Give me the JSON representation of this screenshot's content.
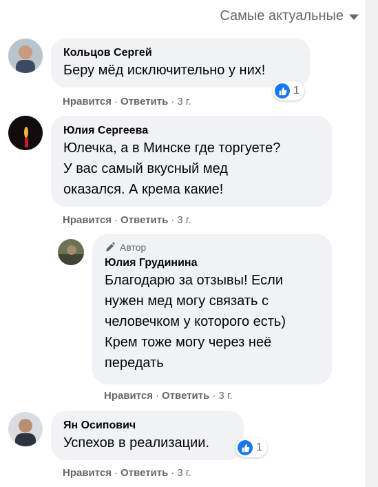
{
  "sort": {
    "label": "Самые актуальные"
  },
  "colors": {
    "bubble": "#f0f2f5",
    "meta": "#65676b",
    "like": "#1877f2"
  },
  "comments": [
    {
      "author": "Кольцов Сергей",
      "lines": [
        "Беру мёд исключительно у них!"
      ],
      "like_label": "Нравится",
      "reply_label": "Ответить",
      "time": "3 г.",
      "reactions": "1"
    },
    {
      "author": "Юлия Сергеева",
      "lines": [
        "Юлечка, а в Минске где торгуете?",
        "У вас самый вкусный мед",
        "оказался. А крема какие!"
      ],
      "like_label": "Нравится",
      "reply_label": "Ответить",
      "time": "3 г."
    },
    {
      "author_badge": "Автор",
      "author": "Юлия Грудинина",
      "lines": [
        "Благодарю за отзывы! Если",
        "нужен мед могу связать с",
        "человечком у которого есть)",
        "Крем тоже могу через неё",
        "передать"
      ],
      "like_label": "Нравится",
      "reply_label": "Ответить",
      "time": "3 г."
    },
    {
      "author": "Ян Осипович",
      "lines": [
        "Успехов в реализации."
      ],
      "like_label": "Нравится",
      "reply_label": "Ответить",
      "time": "3 г.",
      "reactions": "1"
    }
  ]
}
